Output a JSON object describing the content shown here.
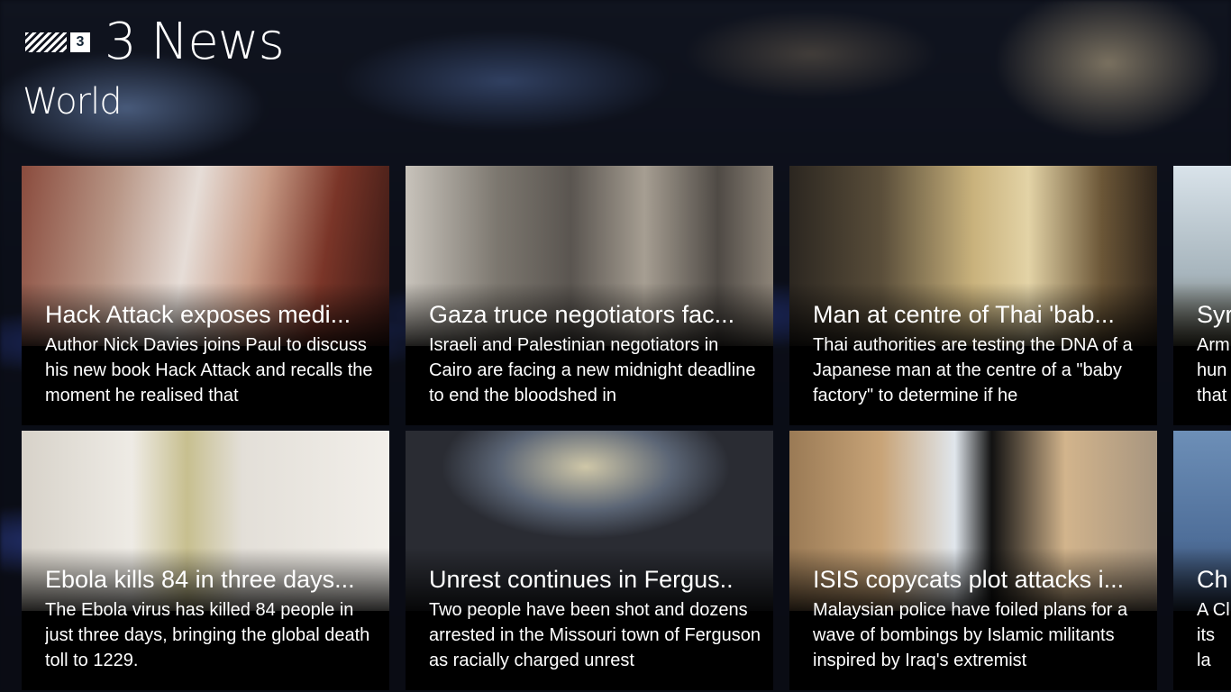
{
  "app": {
    "title": "3 News",
    "logo_badge": "3"
  },
  "section": {
    "title": "World"
  },
  "tiles": [
    {
      "title": "Hack Attack exposes medi...",
      "summary": "Author Nick Davies joins Paul to discuss his new book Hack Attack and recalls the moment he realised that"
    },
    {
      "title": "Gaza truce negotiators fac...",
      "summary": "Israeli and Palestinian negotiators in Cairo are facing a new midnight deadline to end the bloodshed in"
    },
    {
      "title": "Man at centre of Thai 'bab...",
      "summary": "Thai authorities are testing the DNA of a Japanese man at the centre of a \"baby factory\" to determine if he"
    },
    {
      "title": "Syr",
      "summary": "Arm hun that"
    },
    {
      "title": "Ebola kills 84 in three days...",
      "summary": "The Ebola virus has killed 84 people in just three days, bringing the global death toll to 1229."
    },
    {
      "title": "Unrest continues in Fergus..",
      "summary": "Two people have been shot and dozens arrested in the Missouri town of Ferguson as racially charged unrest"
    },
    {
      "title": "ISIS copycats plot attacks i...",
      "summary": "Malaysian police have foiled plans for a wave of bombings by Islamic militants inspired by Iraq's extremist"
    },
    {
      "title": "Ch",
      "summary": "A Cl its la cont"
    }
  ]
}
